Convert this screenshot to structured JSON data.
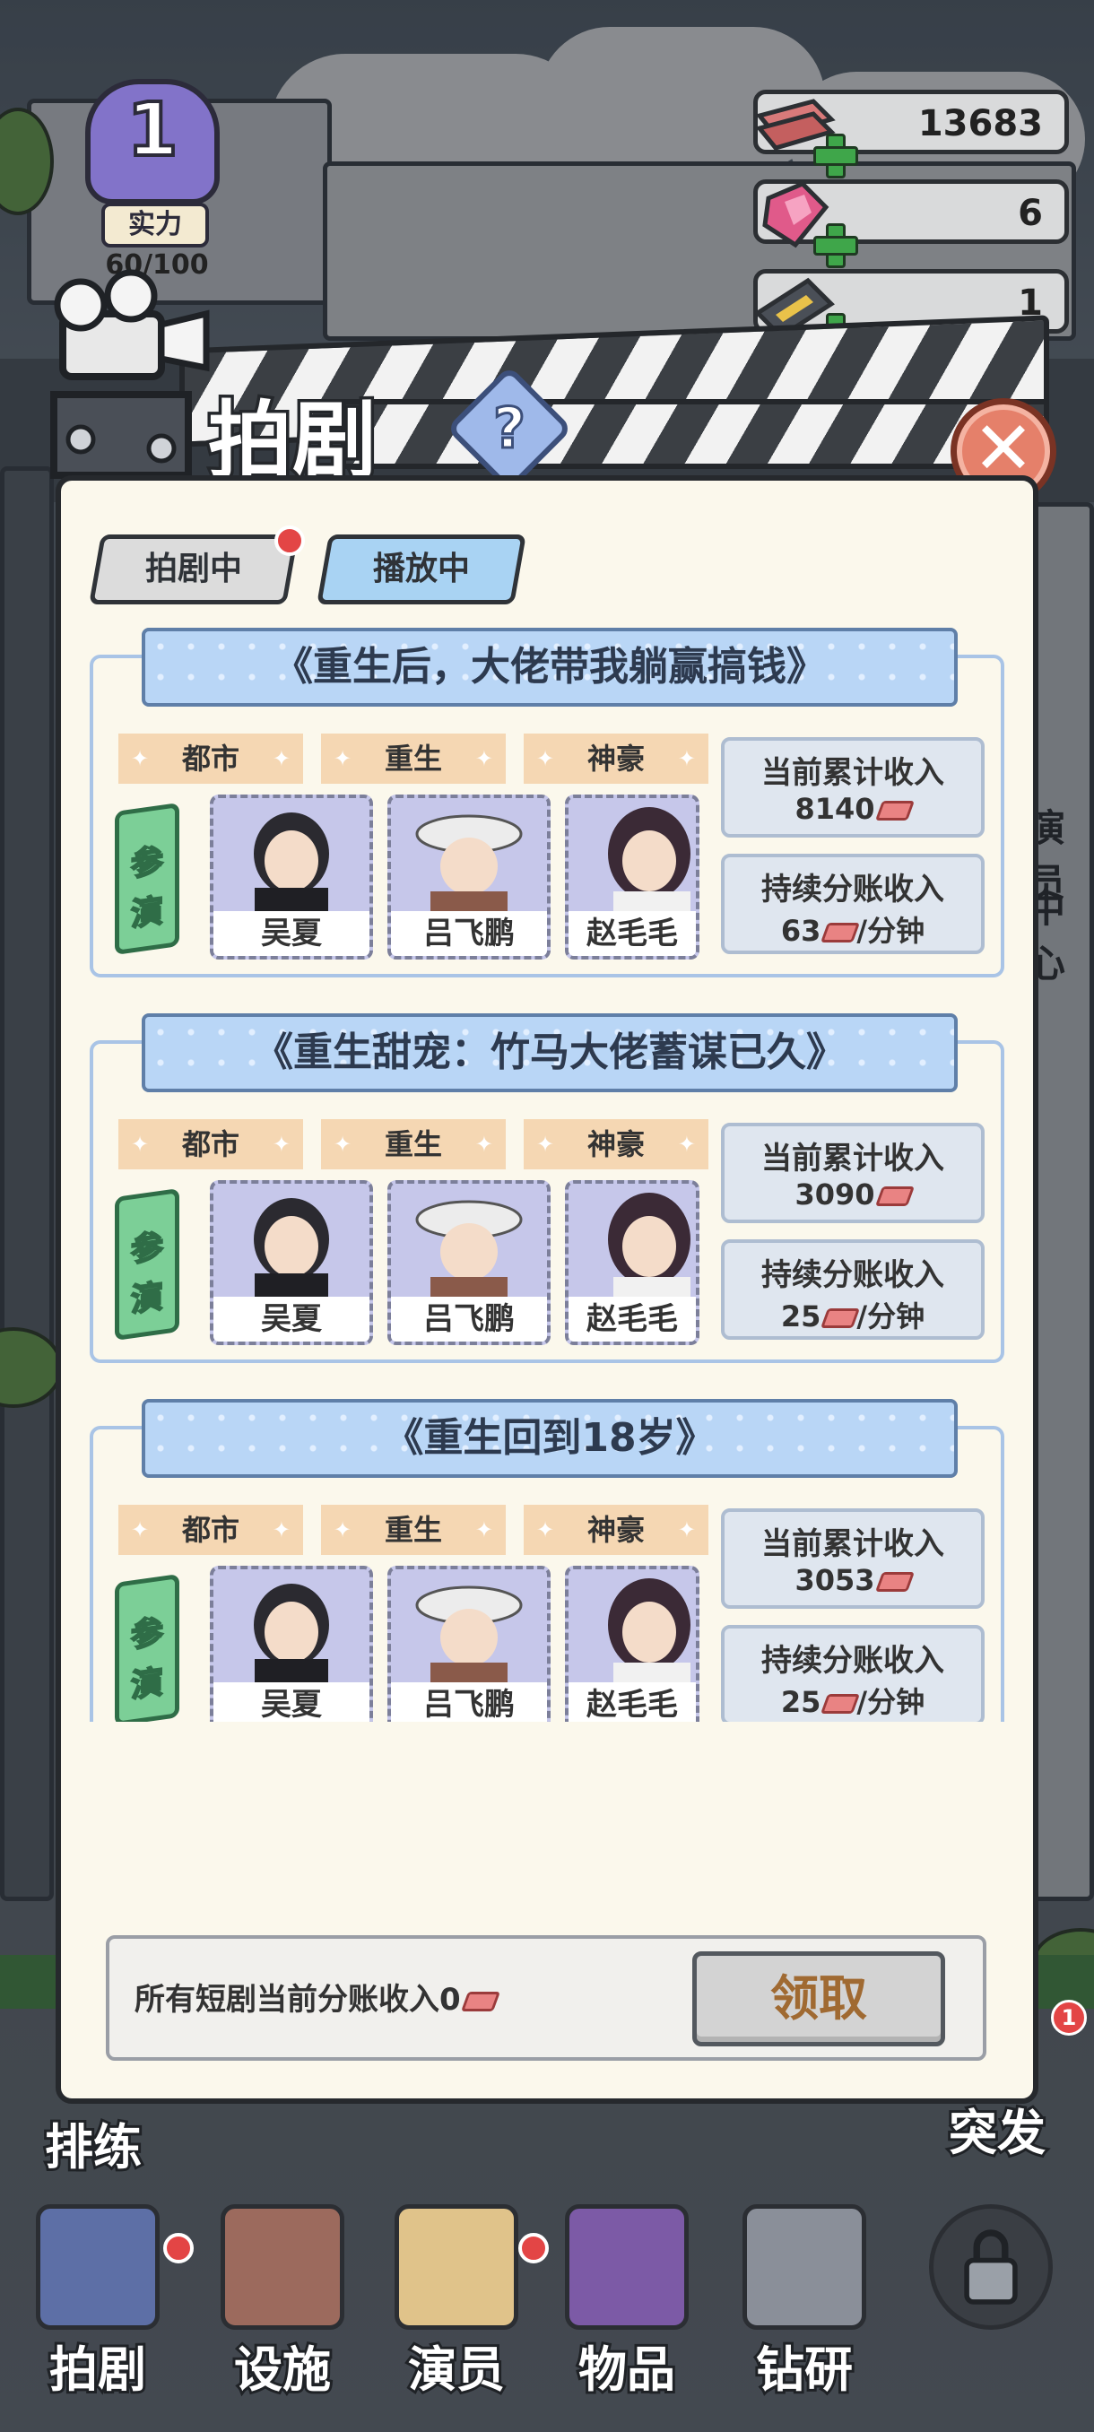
{
  "hud": {
    "level": "1",
    "level_label": "实力",
    "level_progress": "60/100",
    "resources": [
      {
        "icon": "cash-stack-icon",
        "value": "13683"
      },
      {
        "icon": "gem-icon",
        "value": "6"
      },
      {
        "icon": "film-ticket-icon",
        "value": "1"
      }
    ]
  },
  "header": {
    "title": "拍剧",
    "help": "?"
  },
  "tabs": [
    {
      "label": "拍剧中",
      "badge": true
    },
    {
      "label": "播放中",
      "active": true
    }
  ],
  "dramas": [
    {
      "title": "《重生后，大佬带我躺赢搞钱》",
      "genres": [
        "都市",
        "重生",
        "神豪"
      ],
      "cast_label": [
        "参",
        "演"
      ],
      "actors": [
        "吴夏",
        "吕飞鹏",
        "赵毛毛"
      ],
      "income_label": "当前累计收入",
      "income_value": "8140",
      "share_label": "持续分账收入",
      "share_value": "63",
      "share_unit": "/分钟"
    },
    {
      "title": "《重生甜宠：竹马大佬蓄谋已久》",
      "genres": [
        "都市",
        "重生",
        "神豪"
      ],
      "cast_label": [
        "参",
        "演"
      ],
      "actors": [
        "吴夏",
        "吕飞鹏",
        "赵毛毛"
      ],
      "income_label": "当前累计收入",
      "income_value": "3090",
      "share_label": "持续分账收入",
      "share_value": "25",
      "share_unit": "/分钟"
    },
    {
      "title": "《重生回到18岁》",
      "genres": [
        "都市",
        "重生",
        "神豪"
      ],
      "cast_label": [
        "参",
        "演"
      ],
      "actors": [
        "吴夏",
        "吕飞鹏",
        "赵毛毛"
      ],
      "income_label": "当前累计收入",
      "income_value": "3053",
      "share_label": "持续分账收入",
      "share_value": "25",
      "share_unit": "/分钟"
    }
  ],
  "footer": {
    "summary_text": "所有短剧当前分账收入0",
    "claim_label": "领取"
  },
  "side": {
    "left_label": "排练",
    "right_label": "突发",
    "right_badge": "1"
  },
  "nav": [
    {
      "label": "拍剧",
      "badge": true,
      "icon": "clapperboard-icon"
    },
    {
      "label": "设施",
      "badge": false,
      "icon": "facility-icon"
    },
    {
      "label": "演员",
      "badge": true,
      "icon": "actor-icon"
    },
    {
      "label": "物品",
      "badge": false,
      "icon": "items-icon"
    },
    {
      "label": "钻研",
      "badge": false,
      "icon": "research-icon"
    },
    {
      "label": "",
      "badge": false,
      "icon": "lock-icon"
    }
  ],
  "background_fragments": [
    "演员",
    "中心"
  ]
}
